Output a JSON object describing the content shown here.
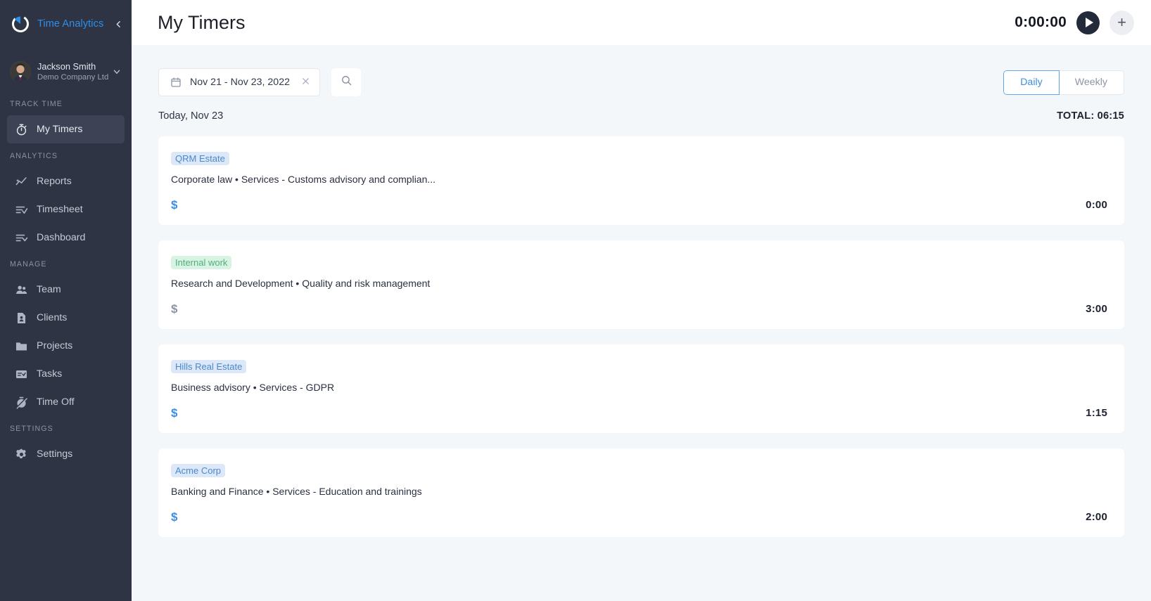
{
  "sidebar": {
    "brand": {
      "name": "Time Analytics",
      "logo_icon": "timer-ring-logo",
      "collapse_icon": "chevron-left-icon"
    },
    "user": {
      "name": "Jackson Smith",
      "company": "Demo Company Ltd",
      "caret_icon": "chevron-down-icon",
      "avatar_icon": "avatar"
    },
    "sections": [
      {
        "title": "TRACK TIME",
        "items": [
          {
            "label": "My Timers",
            "icon": "stopwatch-icon",
            "active": true
          }
        ]
      },
      {
        "title": "ANALYTICS",
        "items": [
          {
            "label": "Reports",
            "icon": "chart-line-icon",
            "active": false
          },
          {
            "label": "Timesheet",
            "icon": "list-check-icon",
            "active": false
          },
          {
            "label": "Dashboard",
            "icon": "list-chevron-icon",
            "active": false
          }
        ]
      },
      {
        "title": "MANAGE",
        "items": [
          {
            "label": "Team",
            "icon": "people-icon",
            "active": false
          },
          {
            "label": "Clients",
            "icon": "contact-card-icon",
            "active": false
          },
          {
            "label": "Projects",
            "icon": "folder-icon",
            "active": false
          },
          {
            "label": "Tasks",
            "icon": "task-list-icon",
            "active": false
          },
          {
            "label": "Time Off",
            "icon": "stopwatch-off-icon",
            "active": false
          }
        ]
      },
      {
        "title": "SETTINGS",
        "items": [
          {
            "label": "Settings",
            "icon": "gear-icon",
            "active": false
          }
        ]
      }
    ]
  },
  "header": {
    "title": "My Timers",
    "timer_value": "0:00:00",
    "play_icon": "play-icon",
    "add_icon": "plus-icon"
  },
  "toolbar": {
    "calendar_icon": "calendar-icon",
    "date_range": "Nov 21 - Nov 23, 2022",
    "clear_icon": "close-icon",
    "search_icon": "search-icon",
    "view_modes": [
      {
        "label": "Daily",
        "active": true
      },
      {
        "label": "Weekly",
        "active": false
      }
    ]
  },
  "day_group": {
    "label": "Today, Nov 23",
    "total": "TOTAL: 06:15"
  },
  "entries": [
    {
      "client": "QRM Estate",
      "client_tag_color": "blue",
      "description": "Corporate law • Services - Customs advisory and complian...",
      "billable_icon": "$",
      "billable_state": "blue",
      "duration": "0:00"
    },
    {
      "client": "Internal work",
      "client_tag_color": "green",
      "description": "Research and Development • Quality and risk management",
      "billable_icon": "$",
      "billable_state": "gray",
      "duration": "3:00"
    },
    {
      "client": "Hills Real Estate",
      "client_tag_color": "blue",
      "description": "Business advisory • Services - GDPR",
      "billable_icon": "$",
      "billable_state": "blue",
      "duration": "1:15"
    },
    {
      "client": "Acme Corp",
      "client_tag_color": "blue",
      "description": "Banking and Finance • Services - Education and trainings",
      "billable_icon": "$",
      "billable_state": "blue",
      "duration": "2:00"
    }
  ],
  "colors": {
    "sidebar_bg": "#2e3444",
    "brand_accent": "#2f8fe8",
    "page_bg": "#f4f7fa",
    "card_bg": "#ffffff",
    "accent_blue": "#3d8ee0",
    "tag_blue_bg": "#dce8f7",
    "tag_green_bg": "#d9f3e3"
  }
}
